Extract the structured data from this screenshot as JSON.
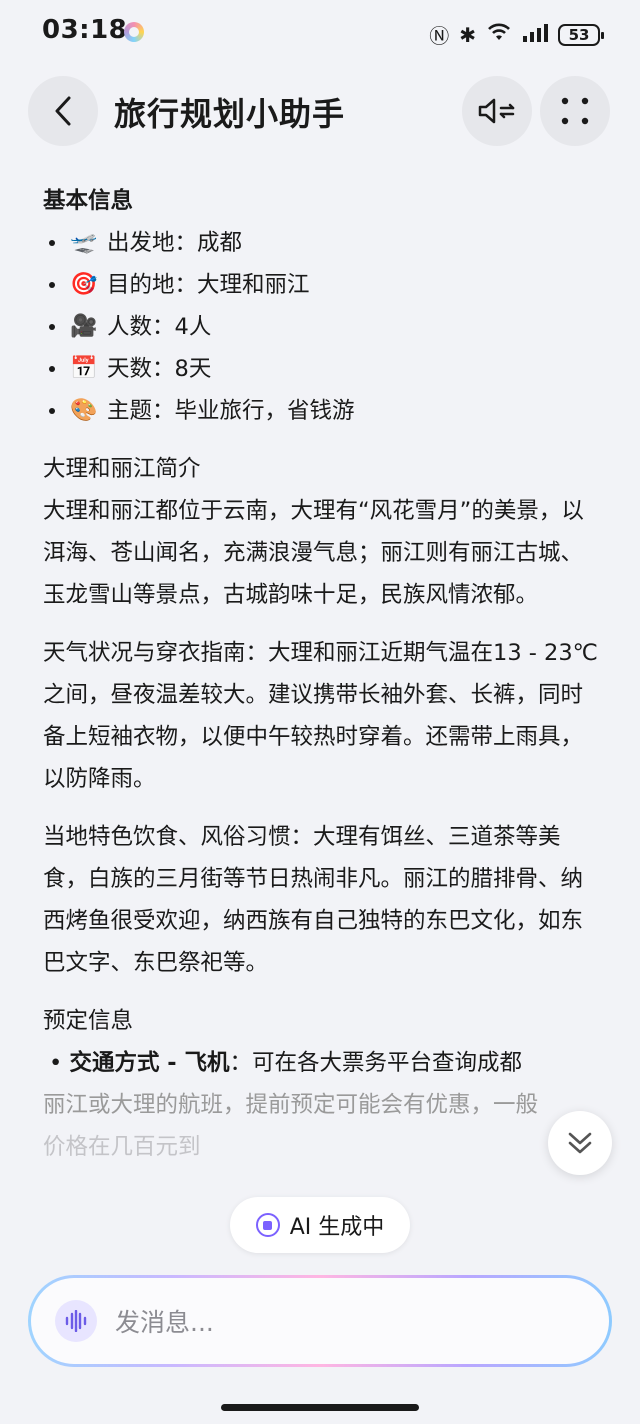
{
  "status_bar": {
    "time": "03:18",
    "battery": "53"
  },
  "header": {
    "title": "旅行规划小助手",
    "back_icon": "chevron-left-icon",
    "sound_icon": "speaker-icon",
    "more_icon": "more-dots-icon"
  },
  "content": {
    "basic_info_title": "基本信息",
    "basic_items": [
      {
        "emoji": "🛫",
        "text": "出发地：成都"
      },
      {
        "emoji": "🎯",
        "text": "目的地：大理和丽江"
      },
      {
        "emoji": "🎥",
        "text": "人数：4人"
      },
      {
        "emoji": "📅",
        "text": "天数：8天"
      },
      {
        "emoji": "🎨",
        "text": "主题：毕业旅行，省钱游"
      }
    ],
    "intro_title": "大理和丽江简介",
    "intro_text": "大理和丽江都位于云南，大理有“风花雪月”的美景，以洱海、苍山闻名，充满浪漫气息；丽江则有丽江古城、玉龙雪山等景点，古城韵味十足，民族风情浓郁。",
    "weather_text": "天气状况与穿衣指南：大理和丽江近期气温在13 - 23℃之间，昼夜温差较大。建议携带长袖外套、长裤，同时备上短袖衣物，以便中午较热时穿着。还需带上雨具，以防降雨。",
    "food_text": "当地特色饮食、风俗习惯：大理有饵丝、三道茶等美食，白族的三月街等节日热闹非凡。丽江的腊排骨、纳西烤鱼很受欢迎，纳西族有自己独特的东巴文化，如东巴文字、东巴祭祀等。",
    "booking_title": "预定信息",
    "booking_item_label": "交通方式 - 飞机",
    "booking_item_text": "：可在各大票务平台查询成都",
    "booking_line2": "丽江或大理的航班，提前预定可能会有优惠，一般",
    "booking_line3": "价格在几百元到"
  },
  "ai_status": "AI 生成中",
  "input": {
    "placeholder": "发消息..."
  }
}
